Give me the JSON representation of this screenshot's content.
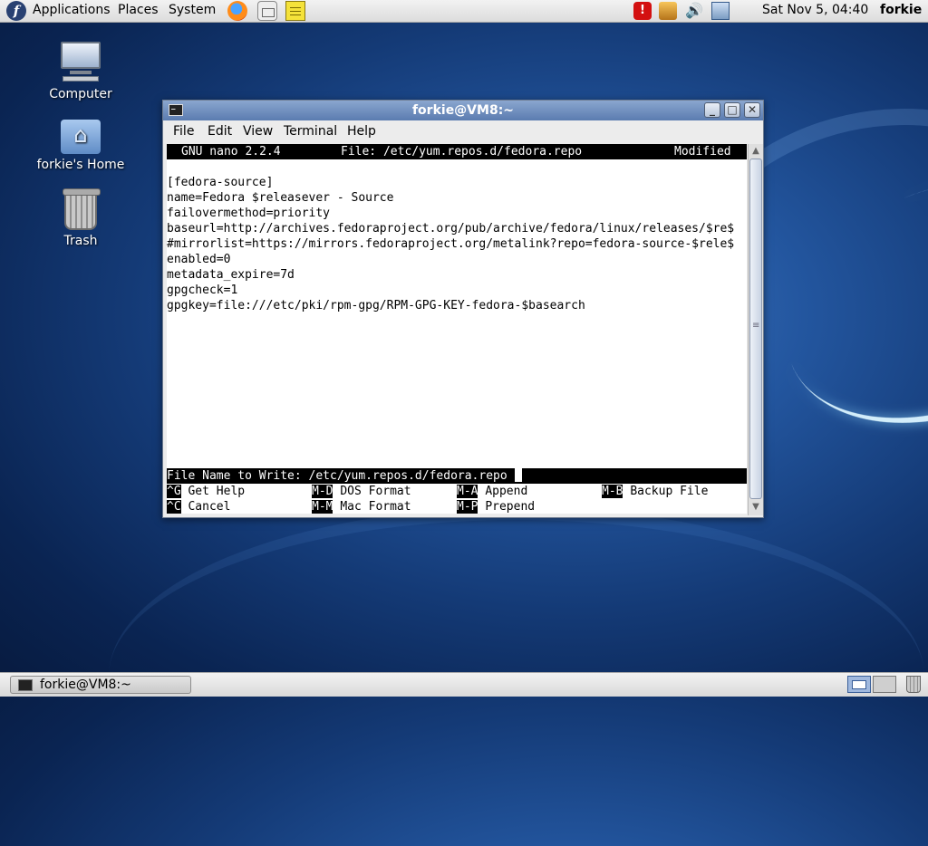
{
  "top_panel": {
    "menus": [
      "Applications",
      "Places",
      "System"
    ],
    "launchers": [
      "firefox-icon",
      "mail-icon",
      "notes-icon"
    ],
    "tray_icons": [
      "alert-icon",
      "update-icon",
      "volume-icon",
      "network-icon"
    ],
    "alert_symbol": "!",
    "volume_symbol": "🔊",
    "clock": "Sat Nov  5, 04:40",
    "user": "forkie"
  },
  "desktop_icons": [
    {
      "label": "Computer",
      "icon": "computer-icon"
    },
    {
      "label": "forkie's Home",
      "icon": "home-folder-icon"
    },
    {
      "label": "Trash",
      "icon": "trash-icon"
    }
  ],
  "window": {
    "title": "forkie@VM8:~",
    "menu": [
      "File",
      "Edit",
      "View",
      "Terminal",
      "Help"
    ],
    "buttons": {
      "minimize": "_",
      "maximize": "□",
      "close": "✕"
    }
  },
  "nano": {
    "version": "GNU nano 2.2.4",
    "file": "File: /etc/yum.repos.d/fedora.repo",
    "status": "Modified",
    "lines": [
      "",
      "[fedora-source]",
      "name=Fedora $releasever - Source",
      "failovermethod=priority",
      "baseurl=http://archives.fedoraproject.org/pub/archive/fedora/linux/releases/$re$",
      "#mirrorlist=https://mirrors.fedoraproject.org/metalink?repo=fedora-source-$rele$",
      "enabled=0",
      "metadata_expire=7d",
      "gpgcheck=1",
      "gpgkey=file:///etc/pki/rpm-gpg/RPM-GPG-KEY-fedora-$basearch"
    ],
    "prompt": "File Name to Write: /etc/yum.repos.d/fedora.repo",
    "shortcuts_row1": [
      {
        "key": "^G",
        "label": "Get Help"
      },
      {
        "key": "M-D",
        "label": "DOS Format"
      },
      {
        "key": "M-A",
        "label": "Append"
      },
      {
        "key": "M-B",
        "label": "Backup File"
      }
    ],
    "shortcuts_row2": [
      {
        "key": "^C",
        "label": "Cancel"
      },
      {
        "key": "M-M",
        "label": "Mac Format"
      },
      {
        "key": "M-P",
        "label": "Prepend"
      }
    ]
  },
  "scrollbar": {
    "up": "▲",
    "down": "▼"
  },
  "bottom_panel": {
    "task": "forkie@VM8:~",
    "workspaces": [
      "workspace-1",
      "workspace-2"
    ]
  }
}
